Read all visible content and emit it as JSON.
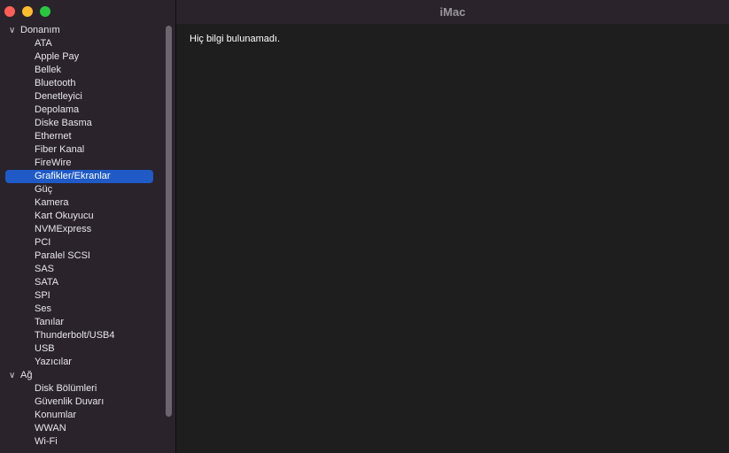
{
  "window": {
    "title": "iMac"
  },
  "sidebar": {
    "groups": [
      {
        "label": "Donanım",
        "items": [
          "ATA",
          "Apple Pay",
          "Bellek",
          "Bluetooth",
          "Denetleyici",
          "Depolama",
          "Diske Basma",
          "Ethernet",
          "Fiber Kanal",
          "FireWire",
          "Grafikler/Ekranlar",
          "Güç",
          "Kamera",
          "Kart Okuyucu",
          "NVMExpress",
          "PCI",
          "Paralel SCSI",
          "SAS",
          "SATA",
          "SPI",
          "Ses",
          "Tanılar",
          "Thunderbolt/USB4",
          "USB",
          "Yazıcılar"
        ]
      },
      {
        "label": "Ağ",
        "items": [
          "Disk Bölümleri",
          "Güvenlik Duvarı",
          "Konumlar",
          "WWAN",
          "Wi-Fi"
        ]
      }
    ],
    "selected": "Grafikler/Ekranlar"
  },
  "content": {
    "message": "Hiç bilgi bulunamadı."
  },
  "icons": {
    "group_chevron": "chevron-down-icon"
  },
  "colors": {
    "selection": "#1f5ac7",
    "sidebar_bg": "#2a232c",
    "content_bg": "#1e1e1e"
  }
}
